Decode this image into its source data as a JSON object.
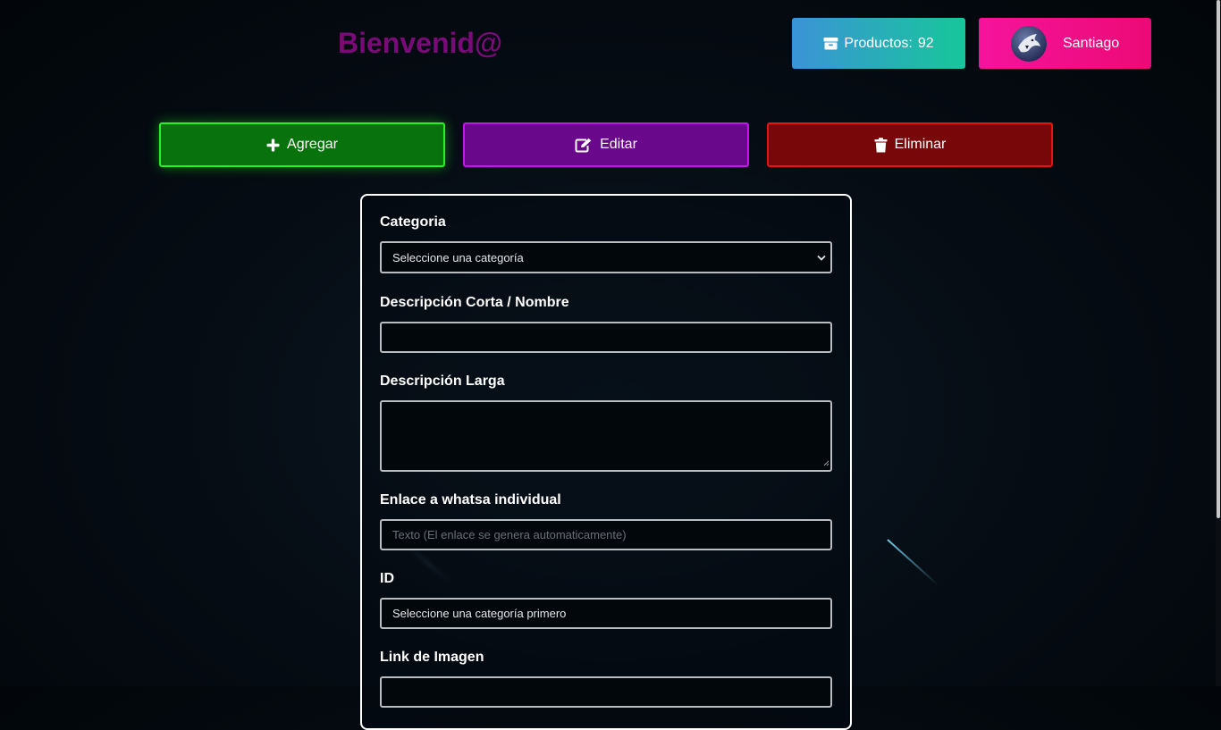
{
  "header": {
    "welcome": "Bienvenid@",
    "products_label": "Productos:",
    "products_count": "92",
    "user_name": "Santiago"
  },
  "actions": {
    "add": "Agregar",
    "edit": "Editar",
    "delete": "Eliminar"
  },
  "form": {
    "category_label": "Categoria",
    "category_select": "Seleccione una categoría",
    "short_desc_label": "Descripción Corta / Nombre",
    "short_desc_value": "",
    "long_desc_label": "Descripción Larga",
    "long_desc_value": "",
    "whatsapp_label": "Enlace a whatsa individual",
    "whatsapp_placeholder": "Texto (El enlace se genera automaticamente)",
    "id_label": "ID",
    "id_value": "Seleccione una categoría primero",
    "image_label": "Link de Imagen",
    "image_value": ""
  },
  "colors": {
    "welcome": "#7a0a78",
    "add_border": "#23f223",
    "edit_border": "#c217e8",
    "delete_border": "#e81212",
    "products_gradient": [
      "#3b93d6",
      "#16c79a"
    ],
    "user_gradient": [
      "#f6139c",
      "#ec0a76"
    ]
  },
  "icons": {
    "products": "box-icon",
    "add": "plus-icon",
    "edit": "edit-icon",
    "delete": "trash-icon",
    "select": "chevron-down-icon"
  }
}
